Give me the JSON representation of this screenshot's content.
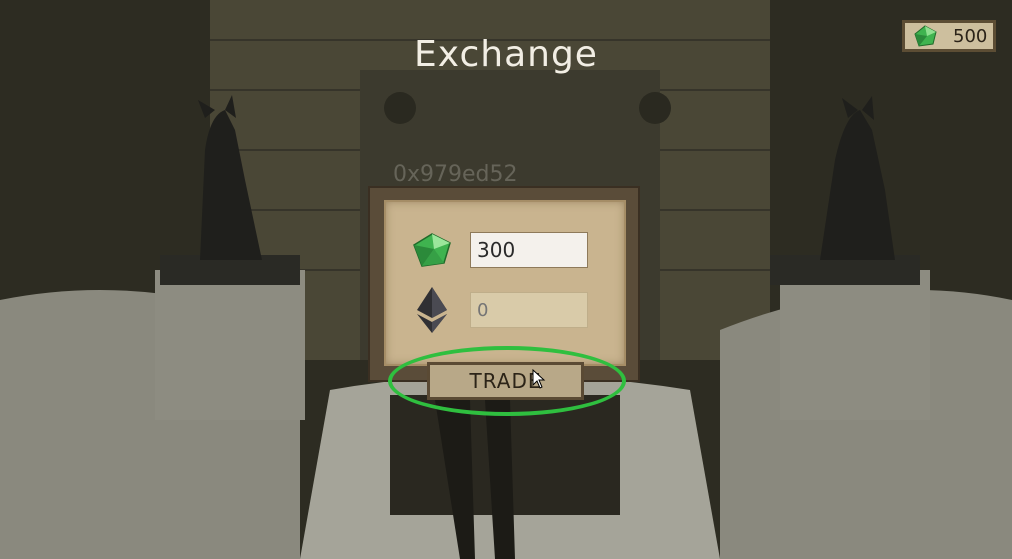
{
  "title": "Exchange",
  "currency": {
    "amount": "500",
    "icon": "green-gem-icon"
  },
  "background_label": "0x979ed52",
  "exchange": {
    "from_icon": "green-gem-icon",
    "from_value": "300",
    "to_icon": "ethereum-icon",
    "to_placeholder": "0"
  },
  "trade_button": {
    "label": "TRADE"
  },
  "colors": {
    "highlight": "#2fbf3f",
    "gem": "#3fb34f",
    "parchment": "#c9b48f",
    "frame": "#5a4c39"
  }
}
